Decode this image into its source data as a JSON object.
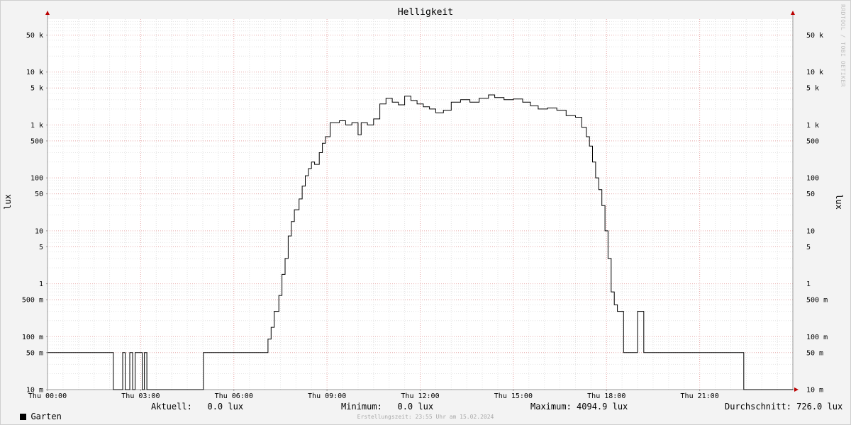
{
  "chart_data": {
    "type": "line",
    "title": "Helligkeit",
    "ylabel": "lux",
    "yscale": "log",
    "ylim": [
      0.01,
      100000
    ],
    "xlim": [
      0,
      24
    ],
    "grid": true,
    "y_ticks": [
      {
        "value": 50000,
        "label": "50 k"
      },
      {
        "value": 10000,
        "label": "10 k"
      },
      {
        "value": 5000,
        "label": "5 k"
      },
      {
        "value": 1000,
        "label": "1 k"
      },
      {
        "value": 500,
        "label": "500"
      },
      {
        "value": 100,
        "label": "100"
      },
      {
        "value": 50,
        "label": "50"
      },
      {
        "value": 10,
        "label": "10"
      },
      {
        "value": 5,
        "label": "5"
      },
      {
        "value": 1,
        "label": "1"
      },
      {
        "value": 0.5,
        "label": "500 m"
      },
      {
        "value": 0.1,
        "label": "100 m"
      },
      {
        "value": 0.05,
        "label": "50 m"
      },
      {
        "value": 0.01,
        "label": "10 m"
      }
    ],
    "x_ticks": [
      {
        "value": 0,
        "label": "Thu 00:00"
      },
      {
        "value": 3,
        "label": "Thu 03:00"
      },
      {
        "value": 6,
        "label": "Thu 06:00"
      },
      {
        "value": 9,
        "label": "Thu 09:00"
      },
      {
        "value": 12,
        "label": "Thu 12:00"
      },
      {
        "value": 15,
        "label": "Thu 15:00"
      },
      {
        "value": 18,
        "label": "Thu 18:00"
      },
      {
        "value": 21,
        "label": "Thu 21:00"
      }
    ],
    "series": [
      {
        "name": "Garten",
        "color": "#000000",
        "points": [
          [
            0,
            0.05
          ],
          [
            2.1,
            0.05
          ],
          [
            2.12,
            0.01
          ],
          [
            2.4,
            0.01
          ],
          [
            2.42,
            0.05
          ],
          [
            2.48,
            0.05
          ],
          [
            2.5,
            0.01
          ],
          [
            2.62,
            0.01
          ],
          [
            2.65,
            0.05
          ],
          [
            2.72,
            0.05
          ],
          [
            2.74,
            0.01
          ],
          [
            2.8,
            0.01
          ],
          [
            2.82,
            0.05
          ],
          [
            3.02,
            0.05
          ],
          [
            3.05,
            0.01
          ],
          [
            3.1,
            0.01
          ],
          [
            3.12,
            0.05
          ],
          [
            3.18,
            0.05
          ],
          [
            3.2,
            0.01
          ],
          [
            5.0,
            0.01
          ],
          [
            5.02,
            0.05
          ],
          [
            7.05,
            0.05
          ],
          [
            7.1,
            0.09
          ],
          [
            7.2,
            0.15
          ],
          [
            7.3,
            0.3
          ],
          [
            7.45,
            0.6
          ],
          [
            7.55,
            1.5
          ],
          [
            7.65,
            3
          ],
          [
            7.75,
            8
          ],
          [
            7.85,
            15
          ],
          [
            7.95,
            25
          ],
          [
            8.1,
            40
          ],
          [
            8.2,
            70
          ],
          [
            8.3,
            110
          ],
          [
            8.4,
            150
          ],
          [
            8.5,
            200
          ],
          [
            8.6,
            180
          ],
          [
            8.75,
            300
          ],
          [
            8.85,
            450
          ],
          [
            8.95,
            600
          ],
          [
            9.1,
            1100
          ],
          [
            9.4,
            1200
          ],
          [
            9.6,
            1000
          ],
          [
            9.8,
            1100
          ],
          [
            10.0,
            650
          ],
          [
            10.1,
            1100
          ],
          [
            10.3,
            1000
          ],
          [
            10.5,
            1300
          ],
          [
            10.7,
            2500
          ],
          [
            10.9,
            3200
          ],
          [
            11.1,
            2700
          ],
          [
            11.3,
            2400
          ],
          [
            11.5,
            3500
          ],
          [
            11.7,
            2900
          ],
          [
            11.9,
            2500
          ],
          [
            12.1,
            2200
          ],
          [
            12.3,
            2000
          ],
          [
            12.5,
            1700
          ],
          [
            12.75,
            1900
          ],
          [
            13.0,
            2700
          ],
          [
            13.3,
            3000
          ],
          [
            13.6,
            2700
          ],
          [
            13.9,
            3200
          ],
          [
            14.2,
            3700
          ],
          [
            14.4,
            3300
          ],
          [
            14.7,
            3000
          ],
          [
            15.0,
            3100
          ],
          [
            15.3,
            2700
          ],
          [
            15.55,
            2300
          ],
          [
            15.8,
            2000
          ],
          [
            16.1,
            2100
          ],
          [
            16.4,
            1900
          ],
          [
            16.7,
            1500
          ],
          [
            17.0,
            1400
          ],
          [
            17.2,
            900
          ],
          [
            17.35,
            600
          ],
          [
            17.45,
            400
          ],
          [
            17.55,
            200
          ],
          [
            17.65,
            100
          ],
          [
            17.75,
            60
          ],
          [
            17.85,
            30
          ],
          [
            17.95,
            10
          ],
          [
            18.05,
            3
          ],
          [
            18.15,
            0.7
          ],
          [
            18.25,
            0.4
          ],
          [
            18.35,
            0.3
          ],
          [
            18.5,
            0.3
          ],
          [
            18.55,
            0.05
          ],
          [
            18.95,
            0.05
          ],
          [
            19.0,
            0.3
          ],
          [
            19.15,
            0.3
          ],
          [
            19.2,
            0.05
          ],
          [
            22.4,
            0.05
          ],
          [
            22.42,
            0.01
          ],
          [
            24.0,
            0.01
          ]
        ]
      }
    ]
  },
  "legend": {
    "series_name": "Garten",
    "aktuell": "Aktuell:   0.0 lux",
    "minimum": "Minimum:   0.0 lux",
    "maximum": "Maximum: 4094.9 lux",
    "durchschnitt": "Durchschnitt: 726.0 lux"
  },
  "credit": "RRDTOOL / TOBI OETIKER",
  "footer": "Erstellungszeit: 23:55 Uhr am 15.02.2024"
}
